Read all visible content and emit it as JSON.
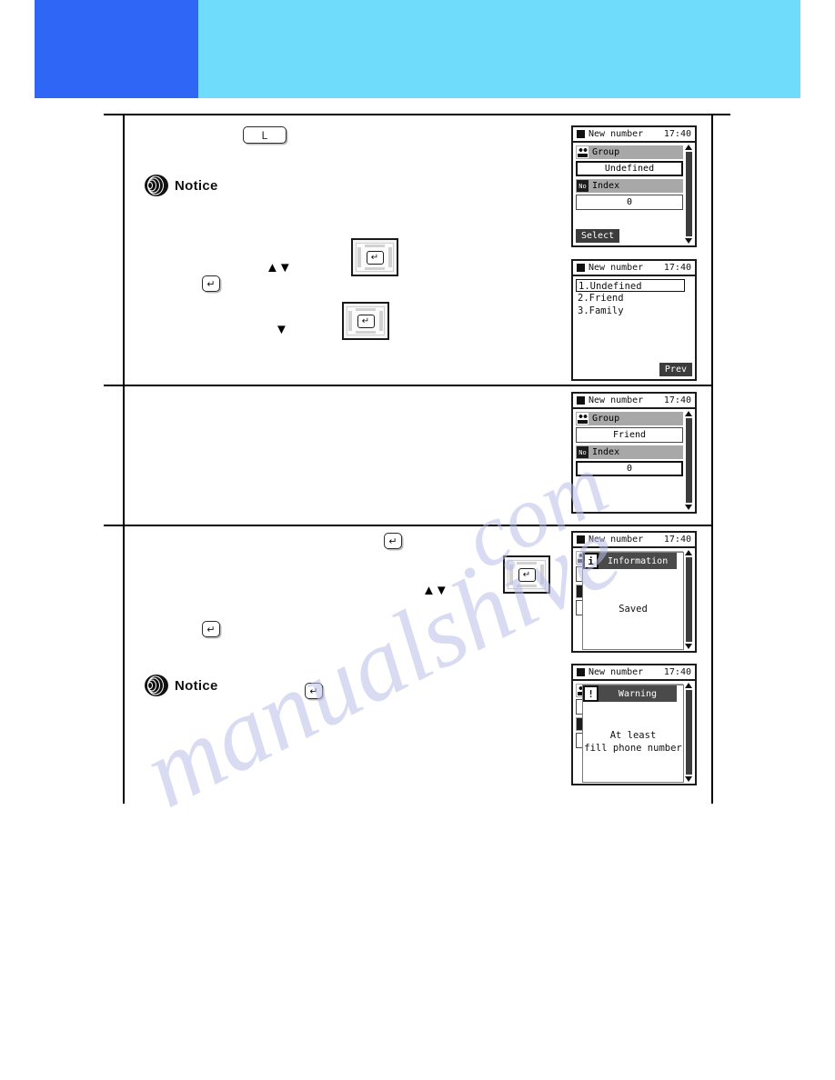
{
  "header": {
    "primary_color": "#2f66f5",
    "secondary_color": "#6fdcfc"
  },
  "notice_label": "Notice",
  "keys": {
    "l_key": "L",
    "enter_key": "↵",
    "up_down_arrows": "▲▼",
    "down_arrow": "▼"
  },
  "screens": [
    {
      "id": "screen-group-undefined",
      "title": "New number",
      "time": "17:40",
      "fields": [
        {
          "badge": "group-icon",
          "label": "Group",
          "value": "Undefined"
        },
        {
          "badge": "No",
          "label": "Index",
          "value": "0"
        }
      ],
      "softkey_left": "Select"
    },
    {
      "id": "screen-group-list",
      "title": "New number",
      "time": "17:40",
      "items": [
        "1.Undefined",
        "2.Friend",
        "3.Family"
      ],
      "selected_index": 0,
      "softkey_right": "Prev"
    },
    {
      "id": "screen-group-friend",
      "title": "New number",
      "time": "17:40",
      "fields": [
        {
          "badge": "group-icon",
          "label": "Group",
          "value": "Friend"
        },
        {
          "badge": "No",
          "label": "Index",
          "value": "0"
        }
      ]
    },
    {
      "id": "screen-information-saved",
      "title": "New number",
      "time": "17:40",
      "dialog": {
        "icon": "i",
        "icon_name": "information-icon",
        "title": "Information",
        "message": "Saved"
      }
    },
    {
      "id": "screen-warning-phone",
      "title": "New number",
      "time": "17:40",
      "dialog": {
        "icon": "!",
        "icon_name": "warning-icon",
        "title": "Warning",
        "message_line1": "At least",
        "message_line2": "fill phone number"
      }
    }
  ],
  "watermark": {
    "line_a": "manualshive",
    "line_b": ".com"
  }
}
